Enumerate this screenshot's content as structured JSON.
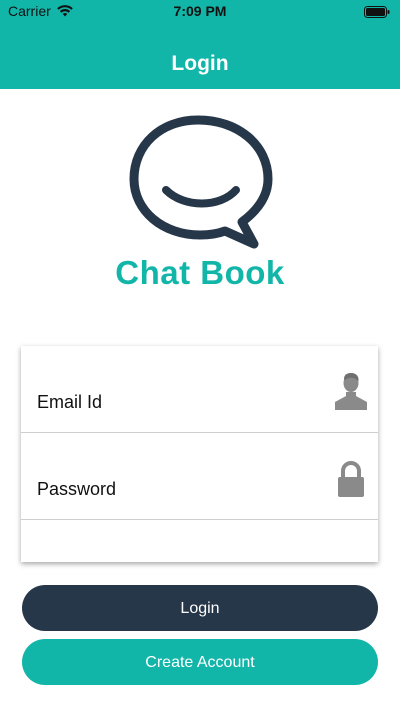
{
  "status_bar": {
    "carrier": "Carrier",
    "time": "7:09 PM"
  },
  "header": {
    "title": "Login"
  },
  "logo": {
    "app_name": "Chat Book",
    "icon": "chat-bubble-smile-icon"
  },
  "form": {
    "email_placeholder": "Email Id",
    "email_value": "",
    "email_icon": "person-icon",
    "password_placeholder": "Password",
    "password_value": "",
    "password_icon": "lock-icon"
  },
  "buttons": {
    "login_label": "Login",
    "create_account_label": "Create Account"
  },
  "colors": {
    "accent": "#12b6a9",
    "dark": "#263749",
    "icon_gray": "#8a8a8a"
  }
}
